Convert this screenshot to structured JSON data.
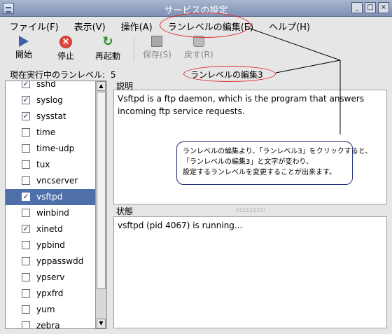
{
  "window": {
    "title": "サービスの設定",
    "buttons": [
      "_",
      "□",
      "×"
    ]
  },
  "menu": [
    "ファイル(F)",
    "表示(V)",
    "操作(A)",
    "ランレベルの編集(E)",
    "ヘルプ(H)"
  ],
  "toolbar": {
    "start": "開始",
    "stop": "停止",
    "restart": "再起動",
    "save": "保存(S)",
    "revert": "戻す(R)"
  },
  "status": {
    "runlevel_label": "現在実行中のランレベル:",
    "runlevel_value": "5",
    "edit_label": "ランレベルの編集3"
  },
  "services": [
    {
      "name": "sshd",
      "checked": true,
      "selected": false
    },
    {
      "name": "syslog",
      "checked": true,
      "selected": false
    },
    {
      "name": "sysstat",
      "checked": true,
      "selected": false
    },
    {
      "name": "time",
      "checked": false,
      "selected": false
    },
    {
      "name": "time-udp",
      "checked": false,
      "selected": false
    },
    {
      "name": "tux",
      "checked": false,
      "selected": false
    },
    {
      "name": "vncserver",
      "checked": false,
      "selected": false
    },
    {
      "name": "vsftpd",
      "checked": true,
      "selected": true
    },
    {
      "name": "winbind",
      "checked": false,
      "selected": false
    },
    {
      "name": "xinetd",
      "checked": true,
      "selected": false
    },
    {
      "name": "ypbind",
      "checked": false,
      "selected": false
    },
    {
      "name": "yppasswdd",
      "checked": false,
      "selected": false
    },
    {
      "name": "ypserv",
      "checked": false,
      "selected": false
    },
    {
      "name": "ypxfrd",
      "checked": false,
      "selected": false
    },
    {
      "name": "yum",
      "checked": false,
      "selected": false
    },
    {
      "name": "zebra",
      "checked": false,
      "selected": false
    }
  ],
  "description": {
    "label": "説明",
    "text": "Vsftpd is a ftp daemon, which is the program that answers incoming ftp service requests."
  },
  "state": {
    "label": "状態",
    "text": "vsftpd (pid 4067) is running..."
  },
  "annotation": {
    "lines": [
      "ランレベルの編集より、「ランレベル3」をクリックすると、",
      "「ランレベルの編集3」と文字が変わり、",
      "設定するランレベルを変更することが出来ます。"
    ],
    "oval_color": "#e0282a",
    "line_color": "#000000"
  },
  "colors": {
    "selection": "#4f6fa8",
    "titlebar": "#8f9fc0"
  }
}
